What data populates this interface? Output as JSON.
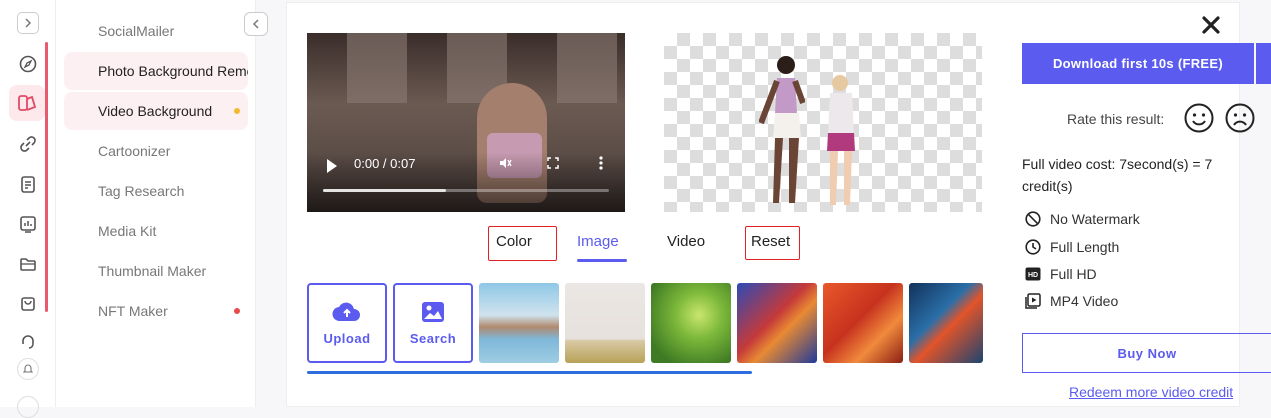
{
  "nav": {
    "items": [
      {
        "label": "SocialMailer",
        "active": false
      },
      {
        "label": "Photo Background Remover",
        "active": true
      },
      {
        "label": "Video Background",
        "active": true,
        "dot": "#f5b82e"
      },
      {
        "label": "Cartoonizer",
        "active": false
      },
      {
        "label": "Tag Research",
        "active": false
      },
      {
        "label": "Media Kit",
        "active": false
      },
      {
        "label": "Thumbnail Maker",
        "active": false
      },
      {
        "label": "NFT Maker",
        "active": false,
        "dot": "#e84a4a"
      }
    ]
  },
  "player": {
    "time": "0:00 / 0:07",
    "progress": 0.43
  },
  "tabs": [
    "Color",
    "Image",
    "Video",
    "Reset"
  ],
  "active_tab": "Image",
  "tiles": {
    "upload_label": "Upload",
    "search_label": "Search"
  },
  "download": {
    "label": "Download first 10s (FREE)"
  },
  "rating": {
    "label": "Rate this result:"
  },
  "cost": {
    "text": "Full video cost: 7second(s) = 7 credit(s)"
  },
  "features": [
    "No Watermark",
    "Full Length",
    "Full HD",
    "MP4 Video"
  ],
  "buy": {
    "label": "Buy Now"
  },
  "redeem": {
    "label": "Redeem more video credit"
  },
  "colors": {
    "accent": "#5b5bf0",
    "annotation": "#e52020",
    "rail_accent": "#e85a70"
  }
}
